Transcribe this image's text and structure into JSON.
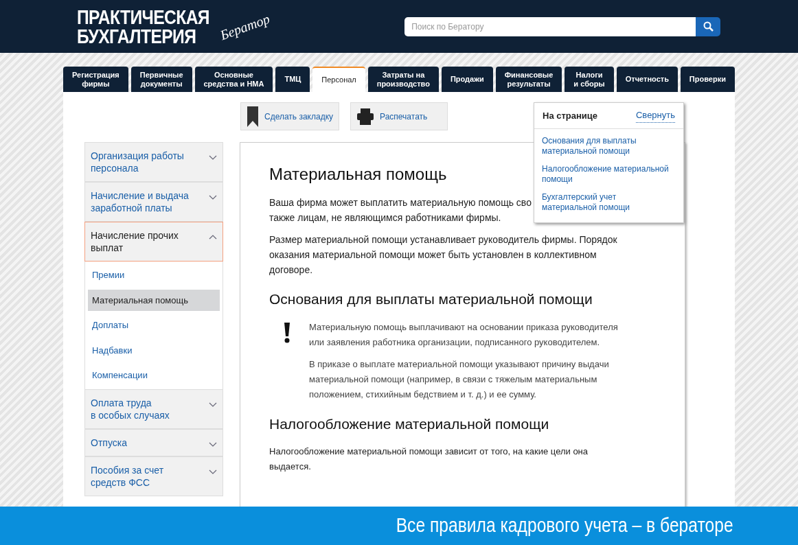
{
  "header": {
    "title_lines": [
      "ПРАКТИЧЕСКАЯ",
      "БУХГАЛТЕРИЯ"
    ],
    "logo_script": "Бератор",
    "search": {
      "placeholder": "Поиск по Бератору"
    }
  },
  "tabs": [
    {
      "label": "Регистрация\nфирмы",
      "selected": false
    },
    {
      "label": "Первичные\nдокументы",
      "selected": false
    },
    {
      "label": "Основные\nсредства и НМА",
      "selected": false
    },
    {
      "label": "ТМЦ",
      "selected": false
    },
    {
      "label": "Персонал",
      "selected": true
    },
    {
      "label": "Затраты на\nпроизводство",
      "selected": false
    },
    {
      "label": "Продажи",
      "selected": false
    },
    {
      "label": "Финансовые\nрезультаты",
      "selected": false
    },
    {
      "label": "Налоги\nи сборы",
      "selected": false
    },
    {
      "label": "Отчетность",
      "selected": false
    },
    {
      "label": "Проверки",
      "selected": false
    }
  ],
  "toolbar": [
    {
      "kind": "bookmark",
      "label": "Сделать закладку"
    },
    {
      "kind": "print",
      "label": "Распечатать"
    }
  ],
  "sidebar": {
    "items": [
      {
        "label": "Организация работы\nперсонала",
        "expanded": false
      },
      {
        "label": "Начисление и выдача\nзаработной платы",
        "expanded": false
      },
      {
        "label": "Начисление прочих\nвыплат",
        "expanded": true,
        "children": [
          {
            "label": "Премии",
            "selected": false
          },
          {
            "label": "Материальная помощь",
            "selected": true
          },
          {
            "label": "Доплаты",
            "selected": false
          },
          {
            "label": "Надбавки",
            "selected": false
          },
          {
            "label": "Компенсации",
            "selected": false
          }
        ]
      },
      {
        "label": "Оплата труда\nв особых случаях",
        "expanded": false
      },
      {
        "label": "Отпуска",
        "expanded": false
      },
      {
        "label": "Пособия за счет\nсредств ФСС",
        "expanded": false
      }
    ]
  },
  "article": {
    "title": "Материальная помощь",
    "intro_lines": [
      "Ваша фирма может выплатить материальную помощь сво",
      "также лицам, не являющимся работниками фирмы."
    ],
    "paragraph": "Размер материальной помощи устанавливает руководитель фирмы. Порядок оказания материальной помощи может быть установлен в коллективном договоре.",
    "sections": [
      {
        "heading": "Основания для выплаты материальной помощи",
        "kind": "notice",
        "paragraphs": [
          "Материальную помощь выплачивают на основании приказа руководителя или заявления работника организации, подписанного руководителем.",
          "В приказе о выплате материальной помощи указывают причину выдачи материальной помощи (например, в связи с тяжелым материальным положением, стихийным бедствием и т. д.) и ее сумму."
        ]
      },
      {
        "heading": "Налогообложение материальной помощи",
        "kind": "plain",
        "paragraphs": [
          "Налогообложение материальной помощи зависит от того, на какие цели она выдается."
        ]
      }
    ]
  },
  "on_page": {
    "title": "На странице",
    "collapse": "Свернуть",
    "links": [
      "Основания для выплаты\nматериальной помощи",
      "Налогообложение материальной\nпомощи",
      "Бухгалтерский учет\nматериальной помощи"
    ]
  },
  "banner": "Все правила кадрового учета – в бераторе"
}
